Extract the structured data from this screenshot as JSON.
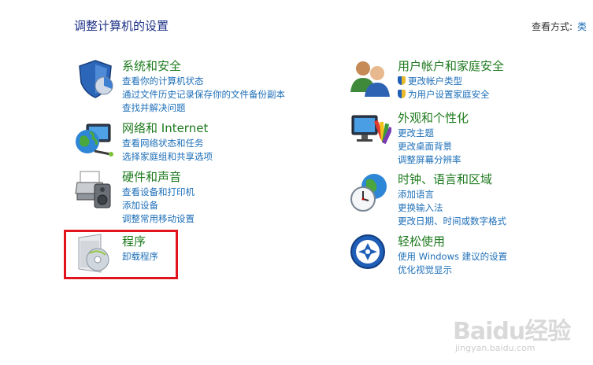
{
  "title": "调整计算机的设置",
  "view_by": {
    "label": "查看方式:",
    "value": "类"
  },
  "categories": [
    {
      "id": "system-security",
      "heading": "系统和安全",
      "icon": "shield-icon",
      "links": [
        "查看你的计算机状态",
        "通过文件历史记录保存你的文件备份副本",
        "查找并解决问题"
      ]
    },
    {
      "id": "network-internet",
      "heading": "网络和 Internet",
      "icon": "network-globe-icon",
      "links": [
        "查看网络状态和任务",
        "选择家庭组和共享选项"
      ]
    },
    {
      "id": "hardware-sound",
      "heading": "硬件和声音",
      "icon": "printer-icon",
      "links": [
        "查看设备和打印机",
        "添加设备",
        "调整常用移动设置"
      ]
    },
    {
      "id": "programs",
      "heading": "程序",
      "icon": "programs-disc-icon",
      "links": [
        "卸载程序"
      ]
    },
    {
      "id": "user-accounts",
      "heading": "用户帐户和家庭安全",
      "icon": "users-icon",
      "links": [
        "更改帐户类型",
        "为用户设置家庭安全"
      ]
    },
    {
      "id": "appearance",
      "heading": "外观和个性化",
      "icon": "monitor-palette-icon",
      "links": [
        "更改主题",
        "更改桌面背景",
        "调整屏幕分辨率"
      ]
    },
    {
      "id": "clock-region",
      "heading": "时钟、语言和区域",
      "icon": "clock-globe-icon",
      "links": [
        "添加语言",
        "更换输入法",
        "更改日期、时间或数字格式"
      ]
    },
    {
      "id": "ease-of-access",
      "heading": "轻松使用",
      "icon": "ease-of-access-icon",
      "links": [
        "使用 Windows 建议的设置",
        "优化视觉显示"
      ]
    }
  ],
  "watermark": {
    "brand": "Baidu经验",
    "url": "jingyan.baidu.com"
  },
  "colors": {
    "heading": "#1e7a1e",
    "link": "#1e6fb8",
    "title": "#1e3287",
    "highlight": "#e0141a"
  }
}
